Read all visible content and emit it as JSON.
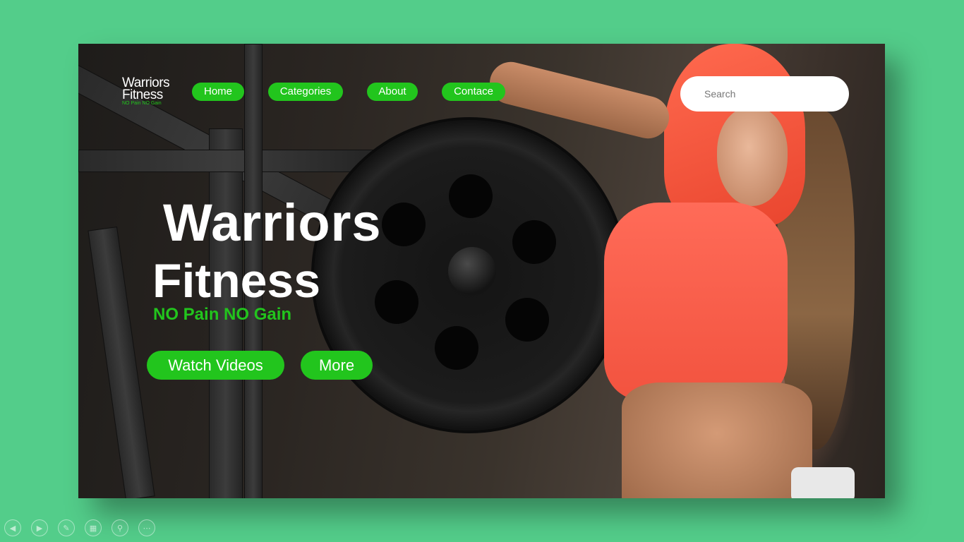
{
  "header": {
    "logo": {
      "line1": "Warriors",
      "line2": "Fitness",
      "tagline": "NO Pain NO Gain"
    },
    "nav": [
      {
        "label": "Home"
      },
      {
        "label": "Categories"
      },
      {
        "label": "About"
      },
      {
        "label": "Contace"
      }
    ],
    "search": {
      "placeholder": "Search",
      "value": ""
    }
  },
  "hero": {
    "title_line1": "Warriors",
    "title_line2": "Fitness",
    "tagline": "NO Pain NO Gain",
    "buttons": [
      {
        "label": "Watch Videos"
      },
      {
        "label": "More"
      }
    ]
  },
  "viewer_toolbar": {
    "buttons": [
      {
        "icon": "previous-icon"
      },
      {
        "icon": "next-icon"
      },
      {
        "icon": "pen-icon"
      },
      {
        "icon": "slides-icon"
      },
      {
        "icon": "zoom-icon"
      },
      {
        "icon": "more-icon"
      }
    ]
  },
  "colors": {
    "background": "#53cd8a",
    "accent_green": "#22c51d",
    "search_bg": "#ffffff",
    "text_light": "#ffffff"
  }
}
